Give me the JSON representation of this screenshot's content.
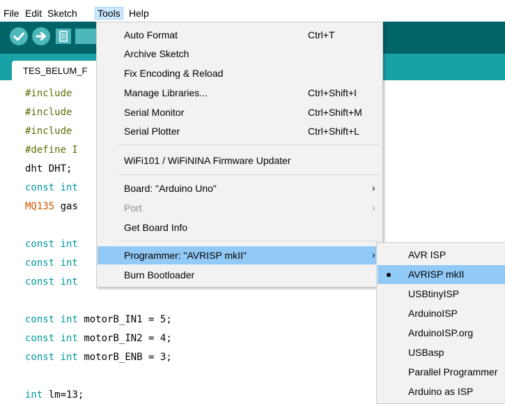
{
  "menubar": {
    "items": [
      "File",
      "Edit",
      "Sketch",
      "Tools",
      "Help"
    ]
  },
  "tab": {
    "label": "TES_BELUM_F"
  },
  "code_lines": [
    "#include",
    "#include",
    "#include",
    "#define I",
    "dht DHT;",
    "const int",
    "MQ135 gas",
    "",
    "const int",
    "const int",
    "const int",
    "",
    "const int motorB_IN1 = 5;",
    "const int motorB_IN2 = 4;",
    "const int motorB_ENB = 3;",
    "",
    "int lm=13;"
  ],
  "tools_menu": {
    "auto_format": {
      "label": "Auto Format",
      "shortcut": "Ctrl+T"
    },
    "archive_sketch": {
      "label": "Archive Sketch"
    },
    "fix_encoding": {
      "label": "Fix Encoding & Reload"
    },
    "manage_libraries": {
      "label": "Manage Libraries...",
      "shortcut": "Ctrl+Shift+I"
    },
    "serial_monitor": {
      "label": "Serial Monitor",
      "shortcut": "Ctrl+Shift+M"
    },
    "serial_plotter": {
      "label": "Serial Plotter",
      "shortcut": "Ctrl+Shift+L"
    },
    "wifi_updater": {
      "label": "WiFi101 / WiFiNINA Firmware Updater"
    },
    "board": {
      "label": "Board: \"Arduino Uno\""
    },
    "port": {
      "label": "Port"
    },
    "board_info": {
      "label": "Get Board Info"
    },
    "programmer": {
      "label": "Programmer: \"AVRISP mkII\""
    },
    "burn_bootloader": {
      "label": "Burn Bootloader"
    },
    "arrow": "›"
  },
  "programmer_submenu": {
    "items": [
      "AVR ISP",
      "AVRISP mkII",
      "USBtinyISP",
      "ArduinoISP",
      "ArduinoISP.org",
      "USBasp",
      "Parallel Programmer",
      "Arduino as ISP"
    ],
    "selected_index": 1
  },
  "colors": {
    "toolbar": "#006468",
    "tabbar": "#17a1a5",
    "button": "#4db7bb",
    "highlight": "#91c9f7"
  }
}
